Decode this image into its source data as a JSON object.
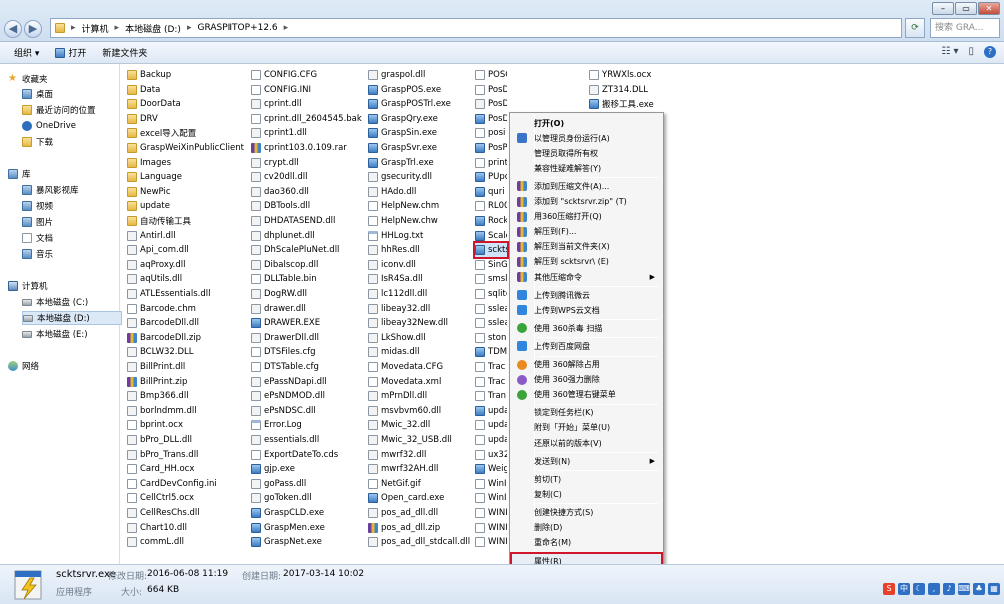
{
  "address": {
    "segments": [
      "计算机",
      "本地磁盘 (D:)",
      "GRASPⅡTOP+12.6"
    ],
    "search_placeholder": "搜索 GRA..."
  },
  "toolbar": {
    "organize": "组织 ▾",
    "open": "打开",
    "new_folder": "新建文件夹"
  },
  "sidebar": {
    "favorites": "收藏夹",
    "desktop": "桌面",
    "recent": "最近访问的位置",
    "onedrive": "OneDrive",
    "downloads": "下载",
    "libraries": "库",
    "videos_lib": "暴风影视库",
    "video": "视频",
    "pictures": "图片",
    "documents": "文档",
    "music": "音乐",
    "computer": "计算机",
    "drive_c": "本地磁盘 (C:)",
    "drive_d": "本地磁盘 (D:)",
    "drive_e": "本地磁盘 (E:)",
    "network": "网络"
  },
  "columns": [
    {
      "files": [
        {
          "name": "Backup",
          "icon": "folder"
        },
        {
          "name": "Data",
          "icon": "folder"
        },
        {
          "name": "DoorData",
          "icon": "folder"
        },
        {
          "name": "DRV",
          "icon": "folder"
        },
        {
          "name": "excel导入配置",
          "icon": "folder"
        },
        {
          "name": "GraspWeiXinPublicClient",
          "icon": "folder"
        },
        {
          "name": "Images",
          "icon": "folder"
        },
        {
          "name": "Language",
          "icon": "folder"
        },
        {
          "name": "NewPic",
          "icon": "folder"
        },
        {
          "name": "update",
          "icon": "folder"
        },
        {
          "name": "自动传输工具",
          "icon": "folder"
        },
        {
          "name": "Antirl.dll",
          "icon": "dll"
        },
        {
          "name": "Api_com.dll",
          "icon": "dll"
        },
        {
          "name": "aqProxy.dll",
          "icon": "dll"
        },
        {
          "name": "aqUtils.dll",
          "icon": "dll"
        },
        {
          "name": "ATLEssentials.dll",
          "icon": "dll"
        },
        {
          "name": "Barcode.chm",
          "icon": "file"
        },
        {
          "name": "BarcodeDll.dll",
          "icon": "dll"
        },
        {
          "name": "BarcodeDll.zip",
          "icon": "zip"
        },
        {
          "name": "BCLW32.DLL",
          "icon": "dll"
        },
        {
          "name": "BillPrint.dll",
          "icon": "dll"
        },
        {
          "name": "BillPrint.zip",
          "icon": "zip"
        },
        {
          "name": "Bmp366.dll",
          "icon": "dll"
        },
        {
          "name": "borlndmm.dll",
          "icon": "dll"
        },
        {
          "name": "bprint.ocx",
          "icon": "file"
        },
        {
          "name": "bPro_DLL.dll",
          "icon": "dll"
        },
        {
          "name": "bPro_Trans.dll",
          "icon": "dll"
        },
        {
          "name": "Card_HH.ocx",
          "icon": "file"
        },
        {
          "name": "CardDevConfig.ini",
          "icon": "file"
        },
        {
          "name": "CellCtrl5.ocx",
          "icon": "file"
        },
        {
          "name": "CellResChs.dll",
          "icon": "dll"
        },
        {
          "name": "Chart10.dll",
          "icon": "dll"
        },
        {
          "name": "commL.dll",
          "icon": "dll"
        }
      ]
    },
    {
      "files": [
        {
          "name": "CONFIG.CFG",
          "icon": "file"
        },
        {
          "name": "CONFIG.INI",
          "icon": "file"
        },
        {
          "name": "cprint.dll",
          "icon": "dll"
        },
        {
          "name": "cprint.dll_2604545.bak",
          "icon": "file"
        },
        {
          "name": "cprint1.dll",
          "icon": "dll"
        },
        {
          "name": "cprint103.0.109.rar",
          "icon": "zip"
        },
        {
          "name": "crypt.dll",
          "icon": "dll"
        },
        {
          "name": "cv20dll.dll",
          "icon": "dll"
        },
        {
          "name": "dao360.dll",
          "icon": "dll"
        },
        {
          "name": "DBTools.dll",
          "icon": "dll"
        },
        {
          "name": "DHDATASEND.dll",
          "icon": "dll"
        },
        {
          "name": "dhplunet.dll",
          "icon": "dll"
        },
        {
          "name": "DhScalePluNet.dll",
          "icon": "dll"
        },
        {
          "name": "Dibalscop.dll",
          "icon": "dll"
        },
        {
          "name": "DLLTable.bin",
          "icon": "file"
        },
        {
          "name": "DogRW.dll",
          "icon": "dll"
        },
        {
          "name": "drawer.dll",
          "icon": "dll"
        },
        {
          "name": "DRAWER.EXE",
          "icon": "exe"
        },
        {
          "name": "DrawerDll.dll",
          "icon": "dll"
        },
        {
          "name": "DTSFiles.cfg",
          "icon": "file"
        },
        {
          "name": "DTSTable.cfg",
          "icon": "file"
        },
        {
          "name": "ePassNDapi.dll",
          "icon": "dll"
        },
        {
          "name": "ePsNDMOD.dll",
          "icon": "dll"
        },
        {
          "name": "ePsNDSC.dll",
          "icon": "dll"
        },
        {
          "name": "Error.Log",
          "icon": "txt"
        },
        {
          "name": "essentials.dll",
          "icon": "dll"
        },
        {
          "name": "ExportDateTo.cds",
          "icon": "file"
        },
        {
          "name": "gjp.exe",
          "icon": "exe"
        },
        {
          "name": "goPass.dll",
          "icon": "dll"
        },
        {
          "name": "goToken.dll",
          "icon": "dll"
        },
        {
          "name": "GraspCLD.exe",
          "icon": "exe"
        },
        {
          "name": "GraspMen.exe",
          "icon": "exe"
        },
        {
          "name": "GraspNet.exe",
          "icon": "exe"
        }
      ]
    },
    {
      "files": [
        {
          "name": "graspol.dll",
          "icon": "dll"
        },
        {
          "name": "GraspPOS.exe",
          "icon": "exe"
        },
        {
          "name": "GraspPOSTrl.exe",
          "icon": "exe"
        },
        {
          "name": "GraspQry.exe",
          "icon": "exe"
        },
        {
          "name": "GraspSin.exe",
          "icon": "exe"
        },
        {
          "name": "GraspSvr.exe",
          "icon": "exe"
        },
        {
          "name": "GraspTrl.exe",
          "icon": "exe"
        },
        {
          "name": "gsecurity.dll",
          "icon": "dll"
        },
        {
          "name": "HAdo.dll",
          "icon": "dll"
        },
        {
          "name": "HelpNew.chm",
          "icon": "file"
        },
        {
          "name": "HelpNew.chw",
          "icon": "file"
        },
        {
          "name": "HHLog.txt",
          "icon": "txt"
        },
        {
          "name": "hhRes.dll",
          "icon": "dll"
        },
        {
          "name": "iconv.dll",
          "icon": "dll"
        },
        {
          "name": "IsR4Sa.dll",
          "icon": "dll"
        },
        {
          "name": "lc112dll.dll",
          "icon": "dll"
        },
        {
          "name": "libeay32.dll",
          "icon": "dll"
        },
        {
          "name": "libeay32New.dll",
          "icon": "dll"
        },
        {
          "name": "LkShow.dll",
          "icon": "dll"
        },
        {
          "name": "midas.dll",
          "icon": "dll"
        },
        {
          "name": "Movedata.CFG",
          "icon": "file"
        },
        {
          "name": "Movedata.xml",
          "icon": "file"
        },
        {
          "name": "mPrnDll.dll",
          "icon": "dll"
        },
        {
          "name": "msvbvm60.dll",
          "icon": "dll"
        },
        {
          "name": "Mwic_32.dll",
          "icon": "dll"
        },
        {
          "name": "Mwic_32_USB.dll",
          "icon": "dll"
        },
        {
          "name": "mwrf32.dll",
          "icon": "dll"
        },
        {
          "name": "mwrf32AH.dll",
          "icon": "dll"
        },
        {
          "name": "NetGif.gif",
          "icon": "file"
        },
        {
          "name": "Open_card.exe",
          "icon": "exe"
        },
        {
          "name": "pos_ad_dll.dll",
          "icon": "dll"
        },
        {
          "name": "pos_ad_dll.zip",
          "icon": "zip"
        },
        {
          "name": "pos_ad_dll_stdcall.dll",
          "icon": "dll"
        }
      ]
    },
    {
      "files": [
        {
          "name": "POSCONFIG.CFG",
          "icon": "file"
        },
        {
          "name": "PosDevConfig.ini",
          "icon": "file"
        },
        {
          "name": "PosDriver.dll",
          "icon": "dll"
        },
        {
          "name": "PosD",
          "icon": "exe"
        },
        {
          "name": "posi",
          "icon": "file"
        },
        {
          "name": "PosP",
          "icon": "exe"
        },
        {
          "name": "print",
          "icon": "file"
        },
        {
          "name": "PUpo",
          "icon": "exe"
        },
        {
          "name": "quri",
          "icon": "exe"
        },
        {
          "name": "RL00",
          "icon": "file"
        },
        {
          "name": "Rock",
          "icon": "exe"
        },
        {
          "name": "Scale",
          "icon": "exe"
        },
        {
          "name": "scktsrvr.exe",
          "icon": "exe"
        },
        {
          "name": "SinG",
          "icon": "file"
        },
        {
          "name": "smsl",
          "icon": "file"
        },
        {
          "name": "sqlite",
          "icon": "file"
        },
        {
          "name": "sslea",
          "icon": "file"
        },
        {
          "name": "sslea",
          "icon": "file"
        },
        {
          "name": "ston",
          "icon": "file"
        },
        {
          "name": "TDMI",
          "icon": "exe"
        },
        {
          "name": "Trac",
          "icon": "file"
        },
        {
          "name": "Trac",
          "icon": "file"
        },
        {
          "name": "Tran",
          "icon": "file"
        },
        {
          "name": "upda",
          "icon": "exe"
        },
        {
          "name": "upda",
          "icon": "file"
        },
        {
          "name": "upda",
          "icon": "file"
        },
        {
          "name": "ux32",
          "icon": "file"
        },
        {
          "name": "Weig",
          "icon": "exe"
        },
        {
          "name": "WinI",
          "icon": "file"
        },
        {
          "name": "WinI",
          "icon": "file"
        },
        {
          "name": "WINI",
          "icon": "file"
        },
        {
          "name": "WINI",
          "icon": "file"
        },
        {
          "name": "WINI",
          "icon": "file"
        }
      ]
    },
    {
      "files": [
        {
          "name": "YRWXls.ocx",
          "icon": "file"
        },
        {
          "name": "ZT314.DLL",
          "icon": "dll"
        },
        {
          "name": "搬移工具.exe",
          "icon": "exe"
        }
      ]
    }
  ],
  "context_menu": {
    "items": [
      {
        "label": "打开(O)",
        "bold": true,
        "icon": ""
      },
      {
        "label": "以管理员身份运行(A)",
        "icon": "shield"
      },
      {
        "label": "管理员取得所有权",
        "icon": ""
      },
      {
        "label": "兼容性疑难解答(Y)",
        "icon": ""
      },
      {
        "sep": true
      },
      {
        "label": "添加到压缩文件(A)...",
        "icon": "zip"
      },
      {
        "label": "添加到 \"scktsrvr.zip\" (T)",
        "icon": "zip"
      },
      {
        "label": "用360压缩打开(Q)",
        "icon": "zip"
      },
      {
        "label": "解压到(F)...",
        "icon": "zip"
      },
      {
        "label": "解压到当前文件夹(X)",
        "icon": "zip"
      },
      {
        "label": "解压到 scktsrvr\\ (E)",
        "icon": "zip"
      },
      {
        "label": "其他压缩命令",
        "icon": "zip",
        "sub": true
      },
      {
        "sep": true
      },
      {
        "label": "上传到腾讯微云",
        "icon": "blue"
      },
      {
        "label": "上传到WPS云文档",
        "icon": "blue"
      },
      {
        "sep": true
      },
      {
        "label": "使用 360杀毒 扫描",
        "icon": "green"
      },
      {
        "sep": true
      },
      {
        "label": "上传到百度网盘",
        "icon": "blue"
      },
      {
        "sep": true
      },
      {
        "label": "使用 360解除占用",
        "icon": "orange"
      },
      {
        "label": "使用 360强力删除",
        "icon": "purple"
      },
      {
        "label": "使用 360管理右键菜单",
        "icon": "green"
      },
      {
        "sep": true
      },
      {
        "label": "锁定到任务栏(K)",
        "icon": ""
      },
      {
        "label": "附到「开始」菜单(U)",
        "icon": ""
      },
      {
        "label": "还原以前的版本(V)",
        "icon": ""
      },
      {
        "sep": true
      },
      {
        "label": "发送到(N)",
        "icon": "",
        "sub": true
      },
      {
        "sep": true
      },
      {
        "label": "剪切(T)",
        "icon": ""
      },
      {
        "label": "复制(C)",
        "icon": ""
      },
      {
        "sep": true
      },
      {
        "label": "创建快捷方式(S)",
        "icon": ""
      },
      {
        "label": "删除(D)",
        "icon": ""
      },
      {
        "label": "重命名(M)",
        "icon": ""
      },
      {
        "sep": true
      },
      {
        "label": "属性(R)",
        "icon": "",
        "props": true
      }
    ]
  },
  "details": {
    "filename": "scktsrvr.exe",
    "type": "应用程序",
    "modified_label": "修改日期:",
    "modified": "2016-06-08 11:19",
    "created_label": "创建日期:",
    "created": "2017-03-14 10:02",
    "size_label": "大小:",
    "size": "664 KB"
  },
  "colors": {
    "highlight": "#d0162a",
    "selection": "#cfe3fa"
  }
}
